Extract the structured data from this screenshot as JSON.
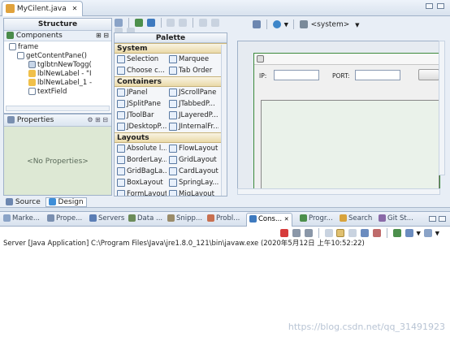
{
  "editor": {
    "tab_title": "MyCilent.java",
    "tab_close": "✕"
  },
  "structure": {
    "title": "Structure",
    "components_label": "Components",
    "tree": [
      "frame",
      "getContentPane()",
      "tglbtnNewTogg(",
      "lblNewLabel - \"I",
      "lblNewLabel_1 -",
      "textField"
    ]
  },
  "properties": {
    "title": "Properties",
    "empty": "<No Properties>"
  },
  "palette": {
    "title": "Palette",
    "system_label": "<system>",
    "categories": [
      {
        "name": "System",
        "items": [
          "Selection",
          "Marquee",
          "Choose c...",
          "Tab Order"
        ]
      },
      {
        "name": "Containers",
        "items": [
          "JPanel",
          "JScrollPane",
          "JSplitPane",
          "JTabbedP...",
          "JToolBar",
          "JLayeredP...",
          "JDesktopP...",
          "JInternalFr..."
        ]
      },
      {
        "name": "Layouts",
        "items": [
          "Absolute l...",
          "FlowLayout",
          "BorderLay...",
          "GridLayout",
          "GridBagLa...",
          "CardLayout",
          "BoxLayout",
          "SpringLay...",
          "FormLayout",
          "MigLayout"
        ]
      }
    ]
  },
  "design": {
    "ip_label": "IP:",
    "port_label": "PORT:"
  },
  "source_tab": "Source",
  "design_tab": "Design",
  "console": {
    "tabs": [
      "Marke...",
      "Prope...",
      "Servers",
      "Data ...",
      "Snipp...",
      "Probl...",
      "Cons...",
      "Progr...",
      "Search",
      "Git St..."
    ],
    "active_tab": "Cons...",
    "line": "Server [Java Application] C:\\Program Files\\Java\\jre1.8.0_121\\bin\\javaw.exe (2020年5月12日 上午10:52:22)",
    "watermark": "https://blog.csdn.net/qq_31491923"
  }
}
